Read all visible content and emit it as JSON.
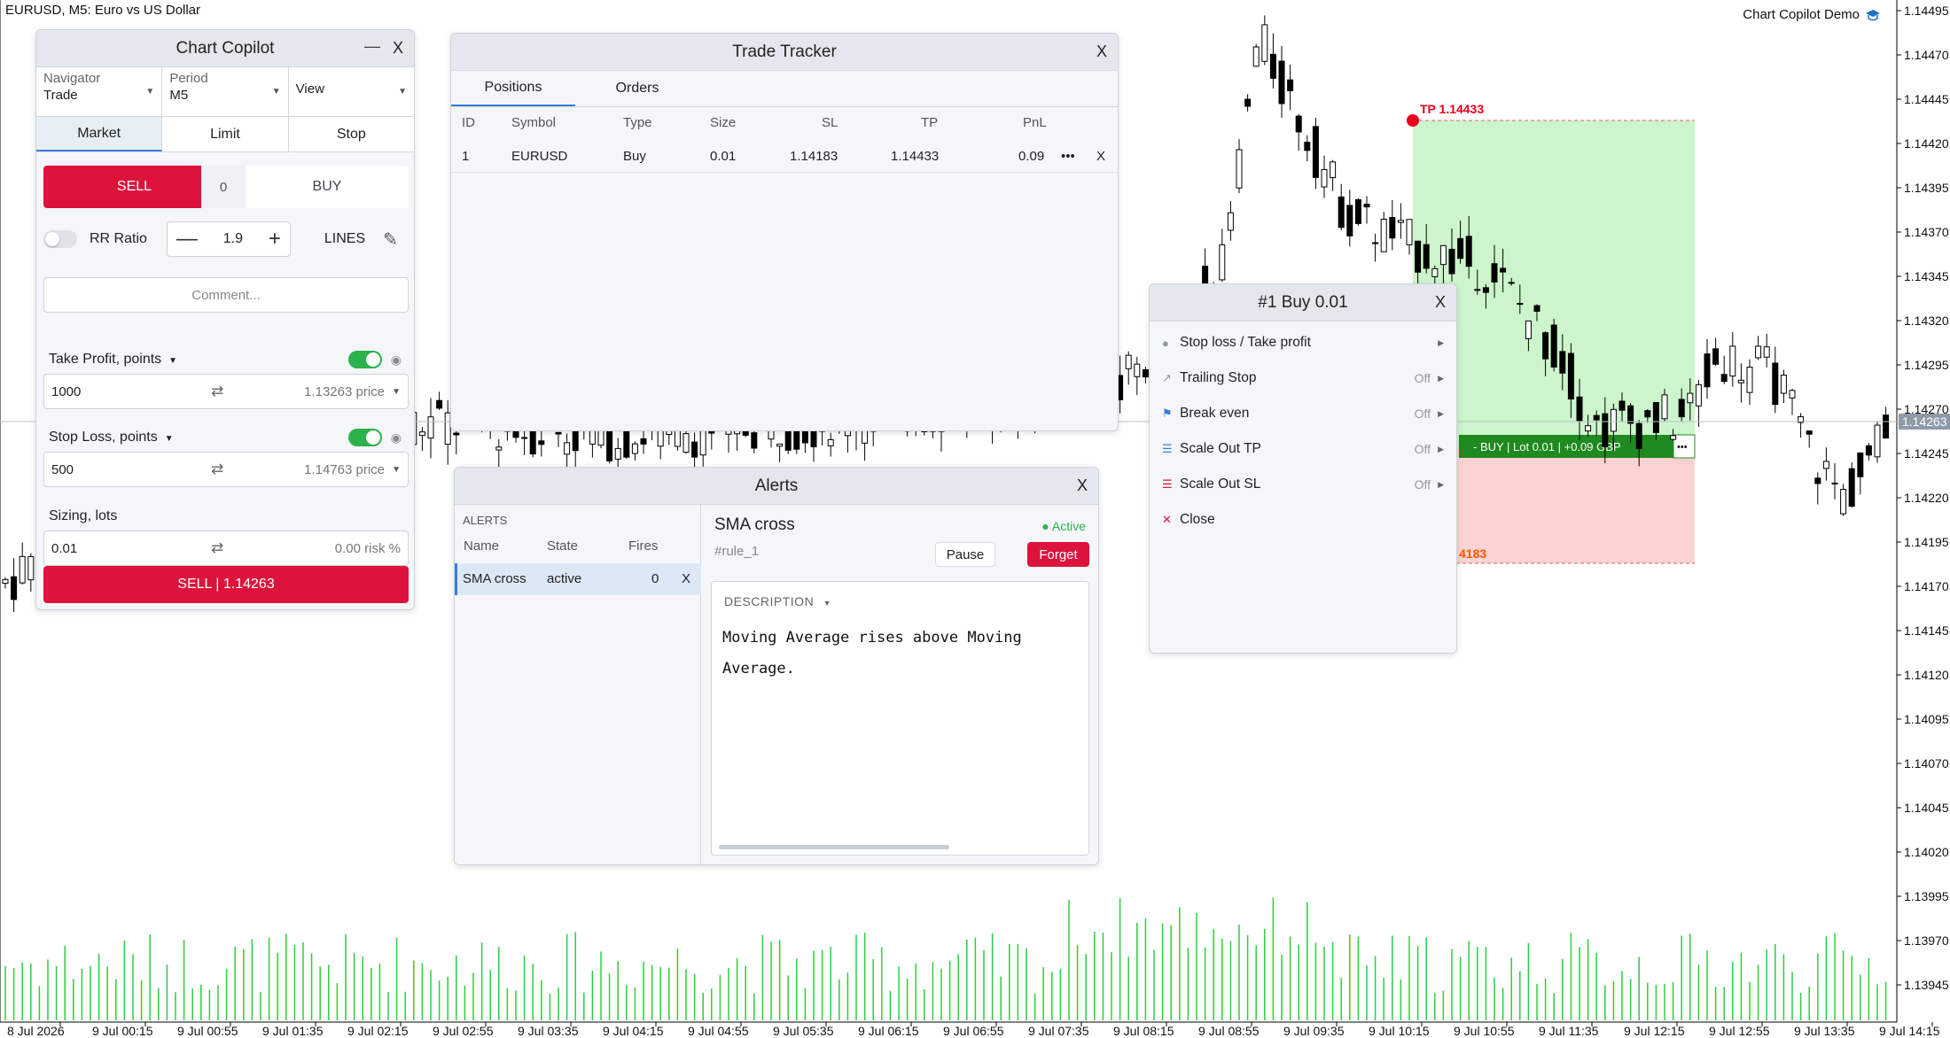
{
  "chart": {
    "symbol_title": "EURUSD, M5:  Euro vs US Dollar",
    "brand": "Chart Copilot Demo",
    "price_labels": [
      "1.14495",
      "1.14470",
      "1.14445",
      "1.14420",
      "1.14395",
      "1.14370",
      "1.14345",
      "1.14320",
      "1.14295",
      "1.14270",
      "1.14245",
      "1.14220",
      "1.14195",
      "1.14170",
      "1.14145",
      "1.14120",
      "1.14095",
      "1.14070",
      "1.14045",
      "1.14020",
      "1.13995",
      "1.13970",
      "1.13945"
    ],
    "current_price": "1.14263",
    "time_labels": [
      "8 Jul 2026",
      "9 Jul 00:15",
      "9 Jul 00:55",
      "9 Jul 01:35",
      "9 Jul 02:15",
      "9 Jul 02:55",
      "9 Jul 03:35",
      "9 Jul 04:15",
      "9 Jul 04:55",
      "9 Jul 05:35",
      "9 Jul 06:15",
      "9 Jul 06:55",
      "9 Jul 07:35",
      "9 Jul 08:15",
      "9 Jul 08:55",
      "9 Jul 09:35",
      "9 Jul 10:15",
      "9 Jul 10:55",
      "9 Jul 11:35",
      "9 Jul 12:15",
      "9 Jul 12:55",
      "9 Jul 13:35",
      "9 Jul 14:15"
    ],
    "tp_label": "TP  1.14433",
    "sl_label_partial": "4183",
    "position_bar": "- BUY | Lot 0.01 | +0.09 GBP",
    "position_bar_more": "•••",
    "colors": {
      "tp_zone": "#ccf5cc",
      "sl_zone": "#fcd2d2",
      "volume": "#2ecc40",
      "position_bar": "#1f8a1f",
      "tp_dot": "#e8001c",
      "sl_text": "#ff5500"
    }
  },
  "copilot": {
    "title": "Chart Copilot",
    "minimize": "—",
    "close": "X",
    "selects": [
      {
        "label": "Navigator",
        "value": "Trade"
      },
      {
        "label": "Period",
        "value": "M5"
      },
      {
        "label": "",
        "value": "View"
      }
    ],
    "order_tabs": [
      "Market",
      "Limit",
      "Stop"
    ],
    "sell_label": "SELL",
    "spread": "0",
    "buy_label": "BUY",
    "rr_label": "RR Ratio",
    "rr_value": "1.9",
    "rr_minus": "—",
    "rr_plus": "+",
    "lines_label": "LINES",
    "comment_placeholder": "Comment...",
    "take_profit": {
      "label": "Take Profit, points",
      "value": "1000",
      "price": "1.13263 price"
    },
    "stop_loss": {
      "label": "Stop Loss, points",
      "value": "500",
      "price": "1.14763 price"
    },
    "sizing": {
      "label": "Sizing, lots",
      "value": "0.01",
      "risk": "0.00 risk %"
    },
    "submit_label": "SELL | 1.14263"
  },
  "tracker": {
    "title": "Trade Tracker",
    "close": "X",
    "tabs": [
      "Positions",
      "Orders"
    ],
    "columns": [
      "ID",
      "Symbol",
      "Type",
      "Size",
      "SL",
      "TP",
      "PnL"
    ],
    "rows": [
      {
        "id": "1",
        "symbol": "EURUSD",
        "type": "Buy",
        "size": "0.01",
        "sl": "1.14183",
        "tp": "1.14433",
        "pnl": "0.09",
        "more": "•••",
        "close": "X"
      }
    ]
  },
  "alerts": {
    "title": "Alerts",
    "close": "X",
    "section": "ALERTS",
    "columns": [
      "Name",
      "State",
      "Fires"
    ],
    "rows": [
      {
        "name": "SMA cross",
        "state": "active",
        "fires": "0",
        "close": "X"
      }
    ],
    "detail": {
      "name": "SMA cross",
      "status": "● Active",
      "rule": "#rule_1",
      "pause": "Pause",
      "forget": "Forget",
      "description_title": "DESCRIPTION",
      "description": "Moving Average rises above Moving Average."
    }
  },
  "position": {
    "title": "#1 Buy 0.01",
    "close": "X",
    "items": [
      {
        "icon": "circle-icon",
        "label": "Stop loss / Take profit",
        "state": ""
      },
      {
        "icon": "trend-arrow-icon",
        "label": "Trailing Stop",
        "state": "Off"
      },
      {
        "icon": "flag-icon",
        "label": "Break even",
        "state": "Off"
      },
      {
        "icon": "scale-out-tp-icon",
        "label": "Scale Out TP",
        "state": "Off"
      },
      {
        "icon": "scale-out-sl-icon",
        "label": "Scale Out SL",
        "state": "Off"
      },
      {
        "icon": "close-x-icon",
        "label": "Close",
        "state": ""
      }
    ]
  }
}
